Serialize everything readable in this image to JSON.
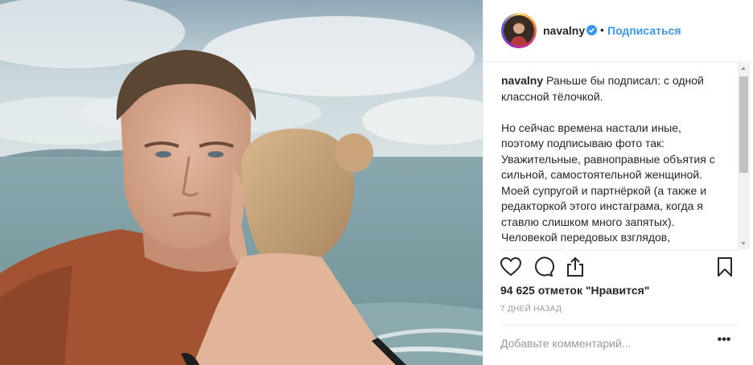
{
  "post": {
    "author": {
      "username": "navalny",
      "verified": true,
      "verified_color": "#3897f0",
      "avatar_icon": "profile-avatar"
    },
    "separator": "•",
    "follow_label": "Подписаться",
    "caption": {
      "username": "navalny",
      "text": " Раньше бы подписал: с одной классной тёлочкой.\n\nНо сейчас времена настали иные, поэтому подписываю фото так: Уважительные, равноправные объятия с сильной, самостоятельной женщиной. Моей супругой и партнёркой (а также и редакторкой этого инстаграма, когда я ставлю слишком много запятых). Человекой передовых взглядов, избавившейся от векового гнёта"
    },
    "likes_text": "94 625 отметок \"Нравится\"",
    "time_ago": "7 ДНЕЙ НАЗАД",
    "comment_placeholder": "Добавьте комментарий...",
    "more_options": "•••",
    "icons": [
      "heart-icon",
      "comment-icon",
      "share-icon",
      "bookmark-icon"
    ]
  },
  "colors": {
    "accent": "#3897f0",
    "text": "#262626",
    "muted": "#999999",
    "border": "#efefef"
  }
}
